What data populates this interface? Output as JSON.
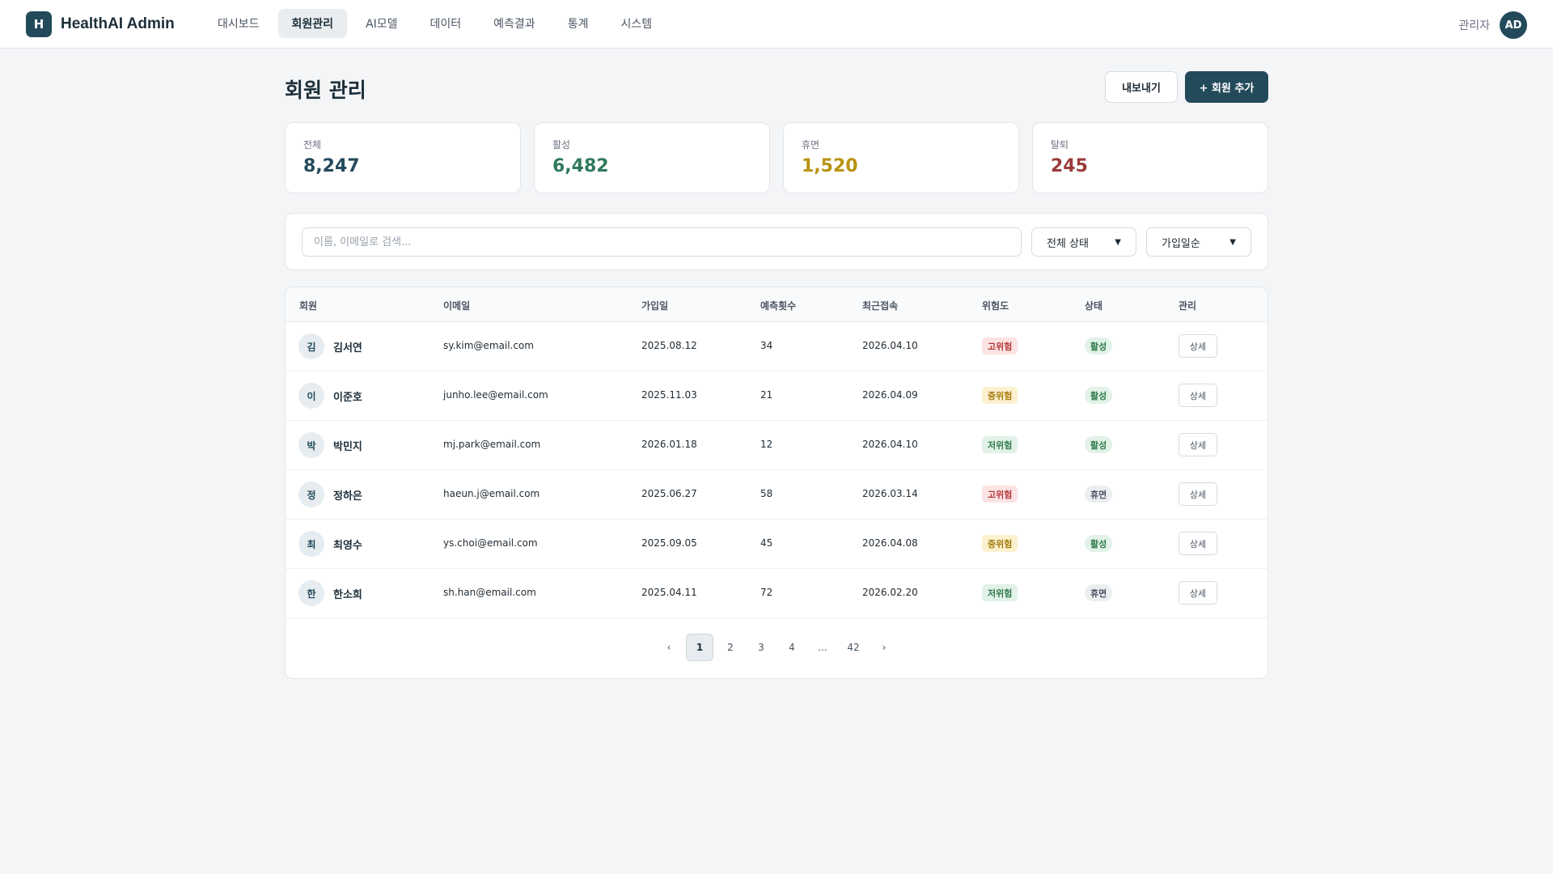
{
  "brand": {
    "logo": "H",
    "name": "HealthAI Admin"
  },
  "nav": {
    "items": [
      {
        "label": "대시보드",
        "active": false
      },
      {
        "label": "회원관리",
        "active": true
      },
      {
        "label": "AI모델",
        "active": false
      },
      {
        "label": "데이터",
        "active": false
      },
      {
        "label": "예측결과",
        "active": false
      },
      {
        "label": "통계",
        "active": false
      },
      {
        "label": "시스템",
        "active": false
      }
    ]
  },
  "user": {
    "label": "관리자",
    "initials": "AD"
  },
  "page": {
    "title": "회원 관리",
    "export_label": "내보내기",
    "add_label": "+ 회원 추가"
  },
  "stats": [
    {
      "label": "전체",
      "value": "8,247",
      "color": "#234a5a"
    },
    {
      "label": "활성",
      "value": "6,482",
      "color": "#2f7a5b"
    },
    {
      "label": "휴면",
      "value": "1,520",
      "color": "#b8930f"
    },
    {
      "label": "탈퇴",
      "value": "245",
      "color": "#9b3b3b"
    }
  ],
  "filters": {
    "search_placeholder": "이름, 이메일로 검색...",
    "status_selected": "전체 상태",
    "sort_selected": "가입일순"
  },
  "table": {
    "headers": {
      "member": "회원",
      "email": "이메일",
      "joined": "가입일",
      "predictions": "예측횟수",
      "last_login": "최근접속",
      "risk": "위험도",
      "status": "상태",
      "manage": "관리"
    },
    "rows": [
      {
        "initial": "김",
        "name": "김서연",
        "email": "sy.kim@email.com",
        "joined": "2025.08.12",
        "predictions": "34",
        "last_login": "2026.04.10",
        "risk": "고위험",
        "risk_level": "high",
        "status": "활성",
        "status_type": "active",
        "action": "상세"
      },
      {
        "initial": "이",
        "name": "이준호",
        "email": "junho.lee@email.com",
        "joined": "2025.11.03",
        "predictions": "21",
        "last_login": "2026.04.09",
        "risk": "중위험",
        "risk_level": "mid",
        "status": "활성",
        "status_type": "active",
        "action": "상세"
      },
      {
        "initial": "박",
        "name": "박민지",
        "email": "mj.park@email.com",
        "joined": "2026.01.18",
        "predictions": "12",
        "last_login": "2026.04.10",
        "risk": "저위험",
        "risk_level": "low",
        "status": "활성",
        "status_type": "active",
        "action": "상세"
      },
      {
        "initial": "정",
        "name": "정하은",
        "email": "haeun.j@email.com",
        "joined": "2025.06.27",
        "predictions": "58",
        "last_login": "2026.03.14",
        "risk": "고위험",
        "risk_level": "high",
        "status": "휴면",
        "status_type": "dormant",
        "action": "상세"
      },
      {
        "initial": "최",
        "name": "최영수",
        "email": "ys.choi@email.com",
        "joined": "2025.09.05",
        "predictions": "45",
        "last_login": "2026.04.08",
        "risk": "중위험",
        "risk_level": "mid",
        "status": "활성",
        "status_type": "active",
        "action": "상세"
      },
      {
        "initial": "한",
        "name": "한소희",
        "email": "sh.han@email.com",
        "joined": "2025.04.11",
        "predictions": "72",
        "last_login": "2026.02.20",
        "risk": "저위험",
        "risk_level": "low",
        "status": "휴면",
        "status_type": "dormant",
        "action": "상세"
      }
    ]
  },
  "pagination": {
    "prev": "‹",
    "pages": [
      "1",
      "2",
      "3",
      "4",
      "...",
      "42"
    ],
    "current": "1",
    "next": "›"
  },
  "colors": {
    "accent": "#234a5a",
    "risk_high": "#b3383a",
    "risk_mid": "#a47a0b",
    "risk_low": "#2f7a4b"
  }
}
